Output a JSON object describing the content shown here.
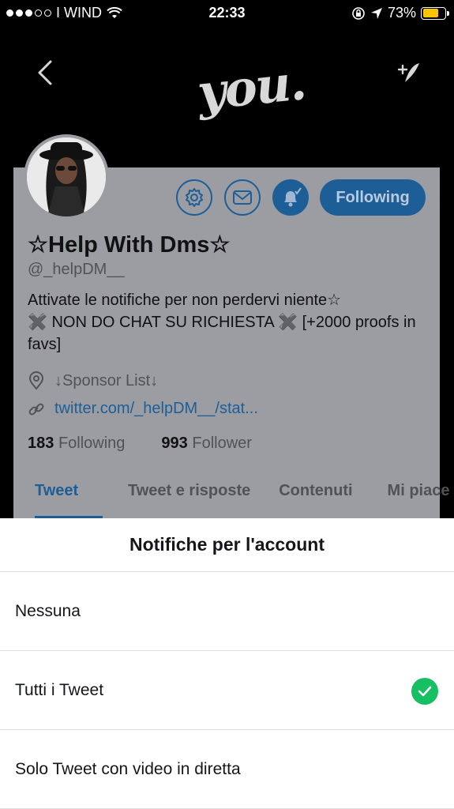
{
  "status_bar": {
    "carrier": "I WIND",
    "time": "22:33",
    "battery": "73%",
    "battery_level": 0.73,
    "icons": [
      "signal-dots-icon",
      "wifi-icon",
      "rotation-lock-icon",
      "location-arrow-icon",
      "battery-icon"
    ]
  },
  "header": {
    "logo_text": "you.",
    "icons": [
      "back-chevron-icon",
      "compose-tweet-icon"
    ]
  },
  "profile": {
    "name": "☆Help With Dms☆",
    "handle": "@_helpDM__",
    "bio_line1": "Attivate le notifiche per non perdervi niente☆",
    "bio_line2": "✖️ NON DO CHAT SU RICHIESTA ✖️  [+2000 proofs in favs]",
    "location": "↓Sponsor List↓",
    "link": "twitter.com/_helpDM__/stat...",
    "following_count": "183",
    "following_label": "Following",
    "follower_count": "993",
    "follower_label": "Follower",
    "follow_button": "Following",
    "action_icons": [
      "gear-icon",
      "mail-icon",
      "bell-icon"
    ]
  },
  "tabs": [
    {
      "label": "Tweet",
      "active": true
    },
    {
      "label": "Tweet e risposte",
      "active": false
    },
    {
      "label": "Contenuti",
      "active": false
    },
    {
      "label": "Mi piace",
      "active": false
    }
  ],
  "sheet": {
    "title": "Notifiche per l'account",
    "options": [
      {
        "label": "Nessuna",
        "selected": false
      },
      {
        "label": "Tutti i Tweet",
        "selected": true
      },
      {
        "label": "Solo Tweet con video in diretta",
        "selected": false
      }
    ]
  },
  "colors": {
    "accent": "#1d9bf0",
    "check": "#17bf63",
    "battery": "#f7c600"
  }
}
